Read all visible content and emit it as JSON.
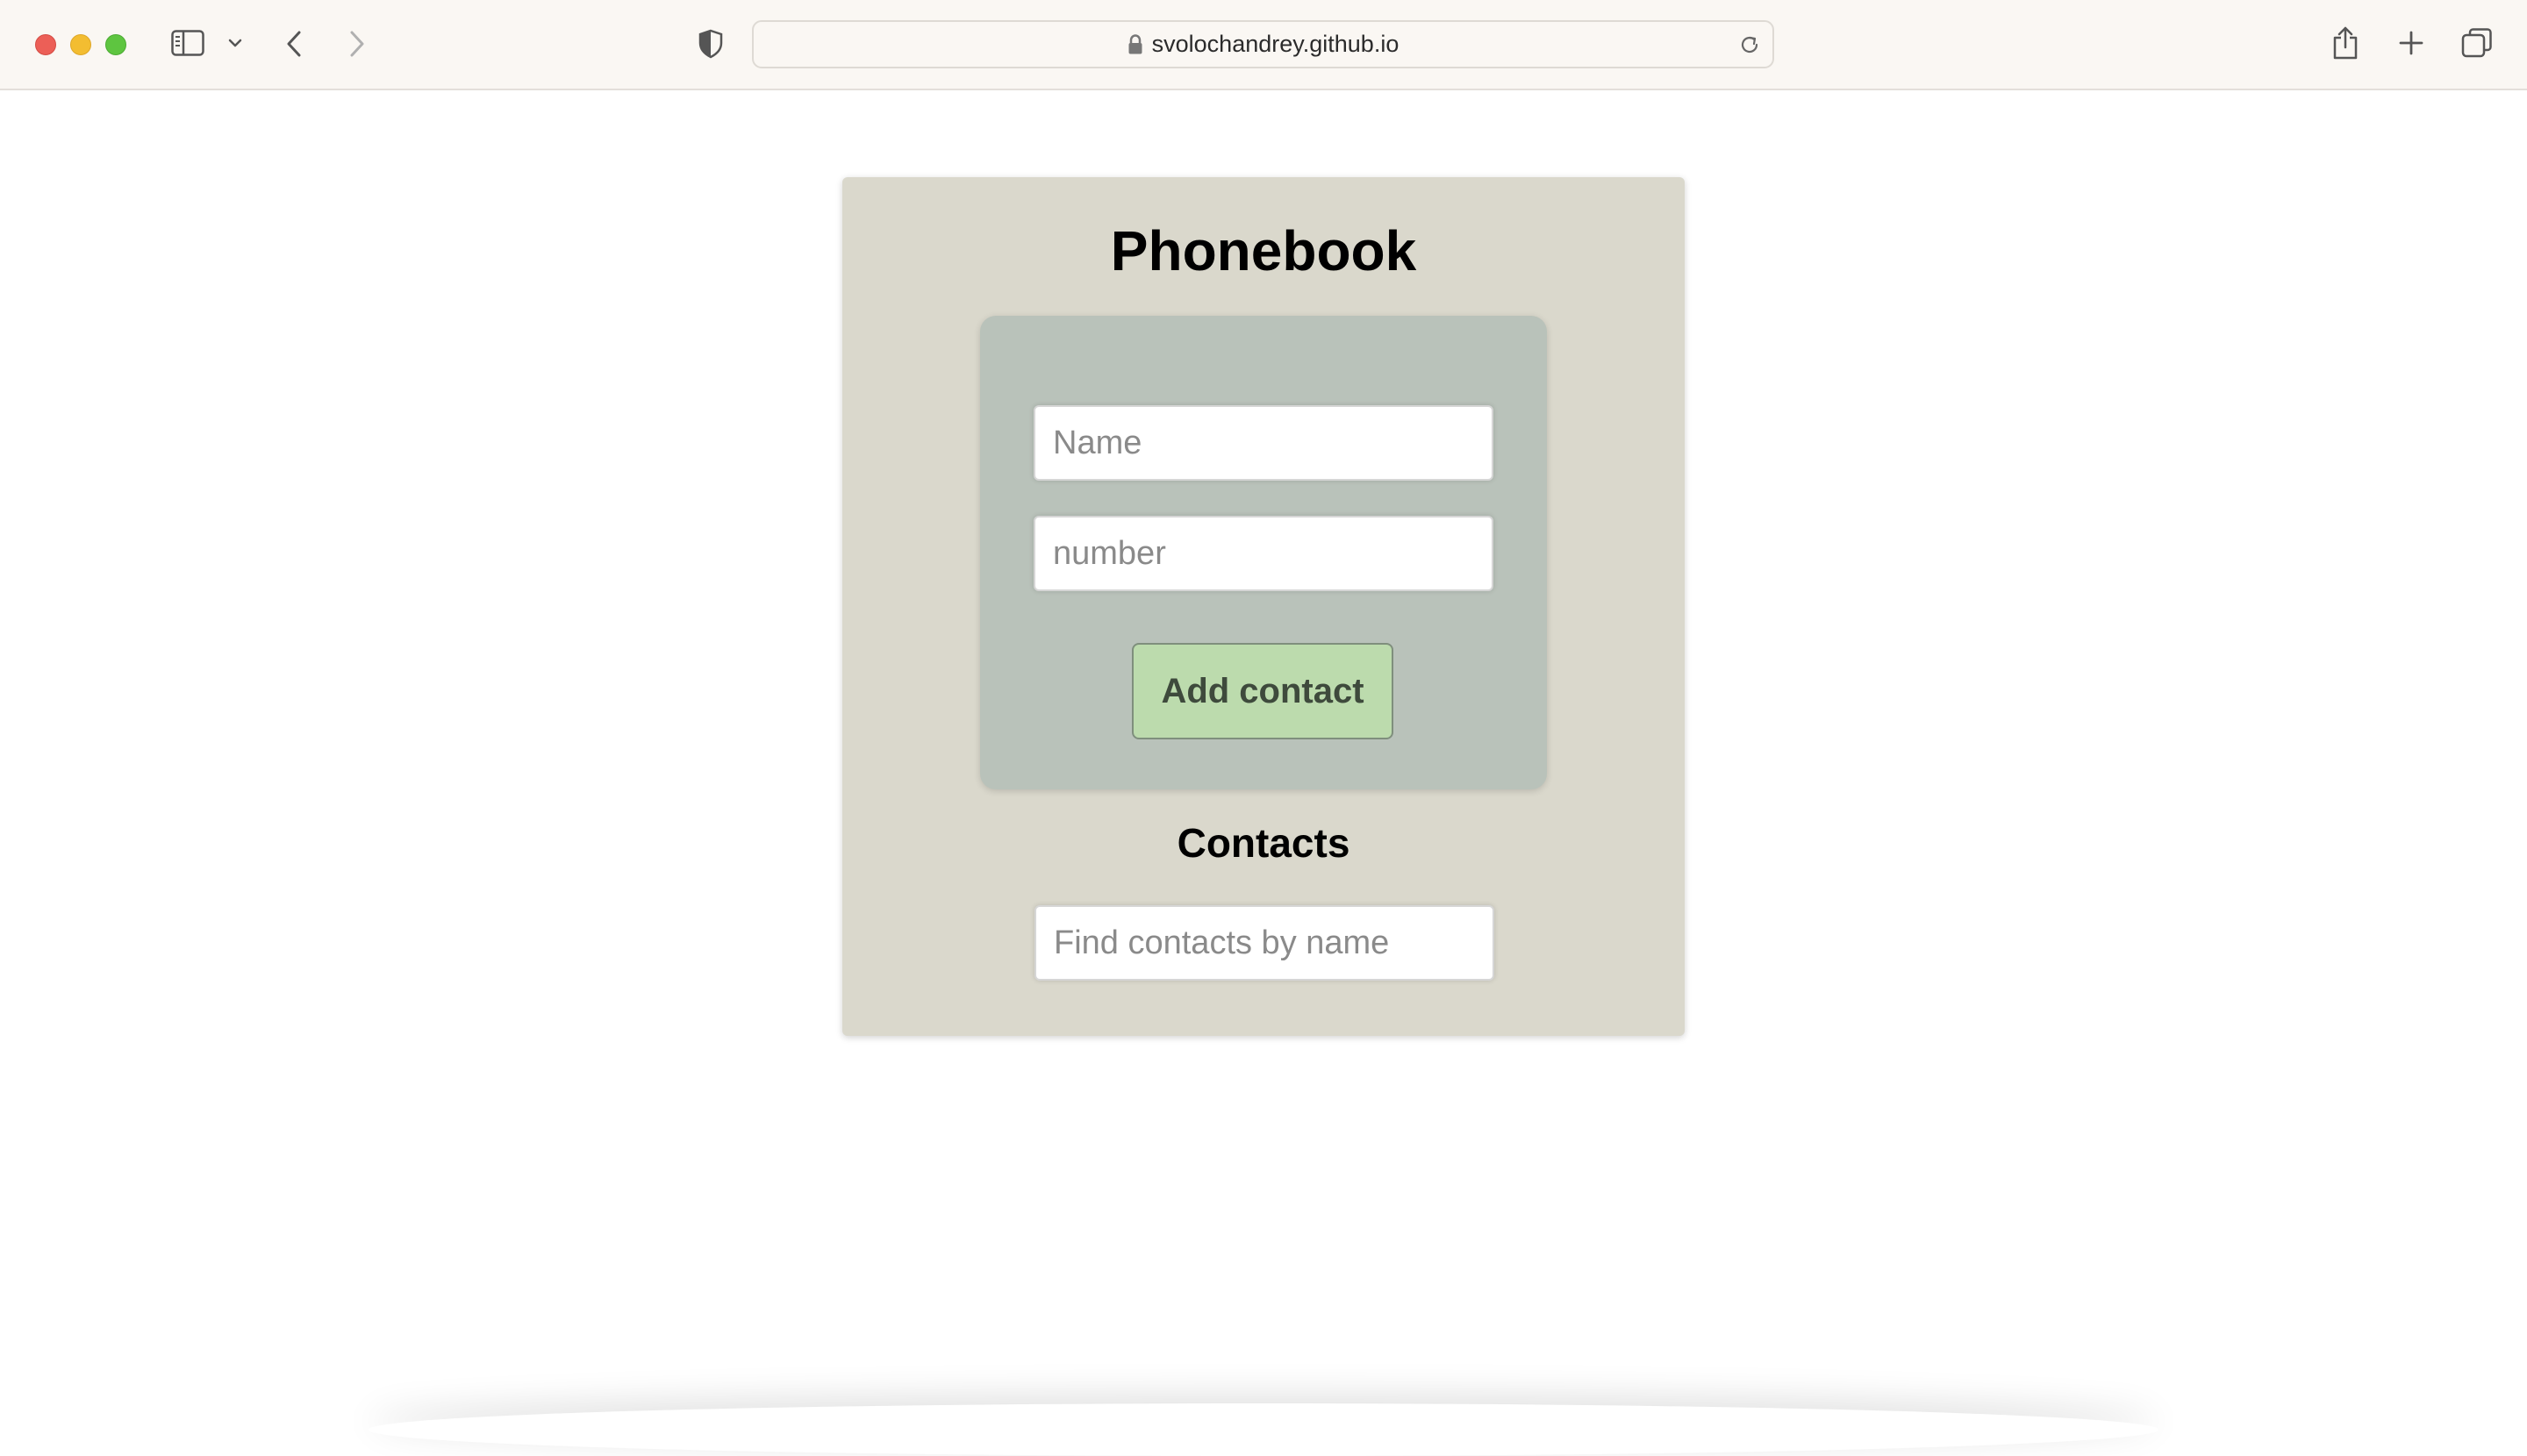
{
  "browser": {
    "url": "svolochandrey.github.io",
    "icons": {
      "sidebar": "sidebar-icon",
      "tab_group_menu": "chevron-down-icon",
      "back": "chevron-left-icon",
      "forward": "chevron-right-icon",
      "privacy": "shield-icon",
      "lock": "lock-icon",
      "reload": "reload-icon",
      "share": "share-icon",
      "new_tab": "plus-icon",
      "tabs_overview": "tabs-icon"
    }
  },
  "app": {
    "title": "Phonebook",
    "form": {
      "name_placeholder": "Name",
      "number_placeholder": "number",
      "submit_label": "Add contact"
    },
    "contacts": {
      "heading": "Contacts",
      "filter_placeholder": "Find contacts by name"
    }
  },
  "colors": {
    "card_background": "#dad8cc",
    "form_background": "#b9c2ba",
    "button_background": "#bcdbad",
    "button_text": "#3e4a3c"
  }
}
